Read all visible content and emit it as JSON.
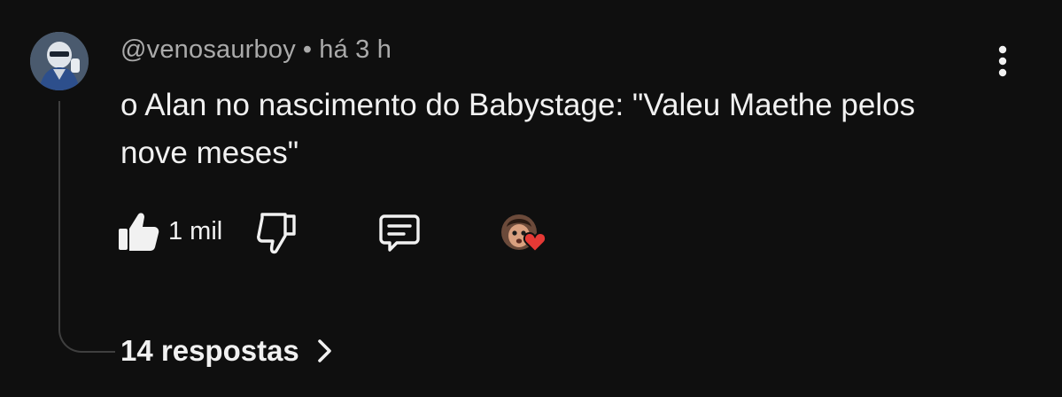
{
  "comment": {
    "author": "@venosaurboy",
    "separator": "•",
    "time": "há 3 h",
    "text": "o Alan no nascimento do Babystage: \"Valeu Maethe pelos nove meses\"",
    "likes": "1 mil",
    "replies_label": "14 respostas"
  },
  "icons": {
    "more": "more-vert-icon",
    "like": "thumb-up-icon",
    "dislike": "thumb-down-icon",
    "reply": "comment-icon",
    "heart": "heart-icon",
    "chevron": "chevron-right-icon"
  },
  "colors": {
    "background": "#0f0f0f",
    "text": "#f1f1f1",
    "secondary_text": "#aaaaaa",
    "heart": "#e53935"
  }
}
